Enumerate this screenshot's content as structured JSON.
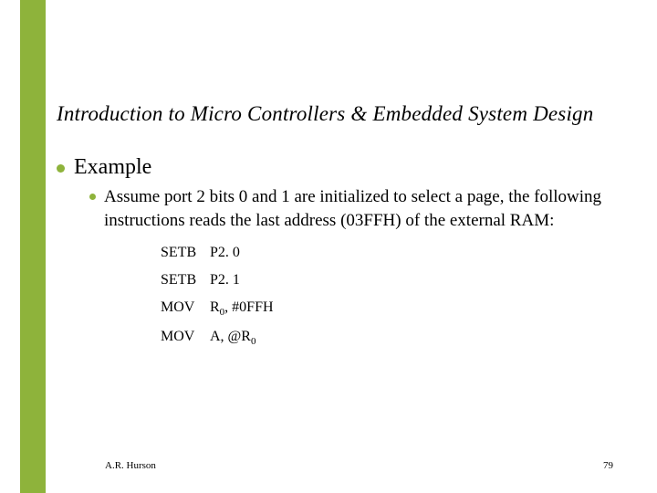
{
  "accent_color": "#8eb33b",
  "title": "Introduction to Micro Controllers & Embedded System Design",
  "bullet1": "Example",
  "bullet2": "Assume port 2 bits 0 and 1 are initialized to select a page, the following instructions reads the last address (03FFH) of the external RAM:",
  "code": {
    "l1_mn": "SETB",
    "l1_op": "P2. 0",
    "l2_mn": "SETB",
    "l2_op": "P2. 1",
    "l3_mn": "MOV",
    "l3_op_a": "R",
    "l3_op_sub": "0",
    "l3_op_b": ", #0FFH",
    "l4_mn": "MOV",
    "l4_op_a": "A, @R",
    "l4_op_sub": "0"
  },
  "footer": {
    "author": "A.R. Hurson",
    "page": "79"
  }
}
